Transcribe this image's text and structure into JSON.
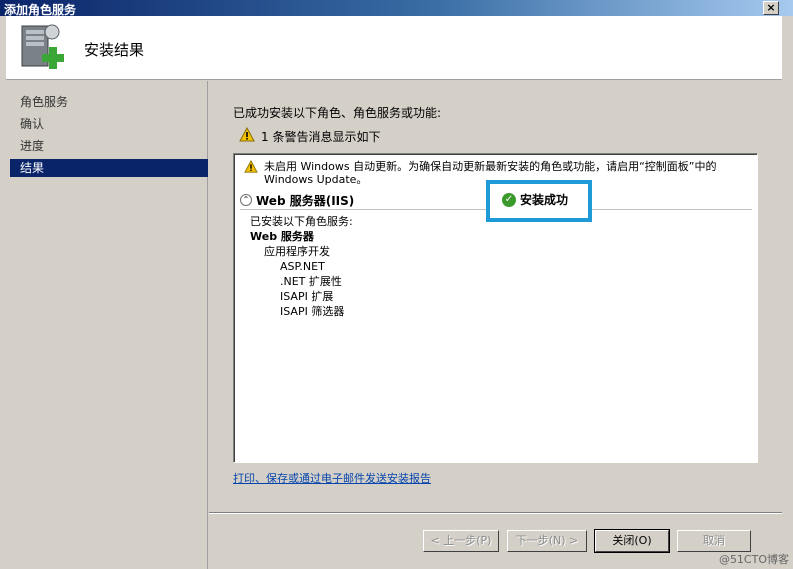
{
  "window": {
    "title": "添加角色服务",
    "close_glyph": "×"
  },
  "header": {
    "title": "安装结果"
  },
  "sidebar": {
    "items": [
      {
        "label": "角色服务",
        "active": false
      },
      {
        "label": "确认",
        "active": false
      },
      {
        "label": "进度",
        "active": false
      },
      {
        "label": "结果",
        "active": true
      }
    ]
  },
  "main": {
    "intro": "已成功安装以下角色、角色服务或功能:",
    "warning_summary": "1 条警告消息显示如下",
    "warning_detail": "未启用 Windows 自动更新。为确保自动更新最新安装的角色或功能，请启用“控制面板”中的 Windows Update。",
    "section_title": "Web 服务器(IIS)",
    "collapse_glyph": "⌃",
    "status": "安装成功",
    "details": {
      "heading": "已安装以下角色服务:",
      "role": "Web 服务器",
      "group": "应用程序开发",
      "items": [
        "ASP.NET",
        ".NET 扩展性",
        "ISAPI 扩展",
        "ISAPI 筛选器"
      ]
    },
    "report_link": "打印、保存或通过电子邮件发送安装报告"
  },
  "buttons": {
    "prev": "< 上一步(P)",
    "next": "下一步(N) >",
    "close": "关闭(O)",
    "cancel": "取消"
  },
  "watermark": "@51CTO博客",
  "colors": {
    "title_bar": "#0a246a",
    "highlight": "#1e9bd7",
    "success": "#3c9a2c",
    "warning": "#f2c200"
  }
}
